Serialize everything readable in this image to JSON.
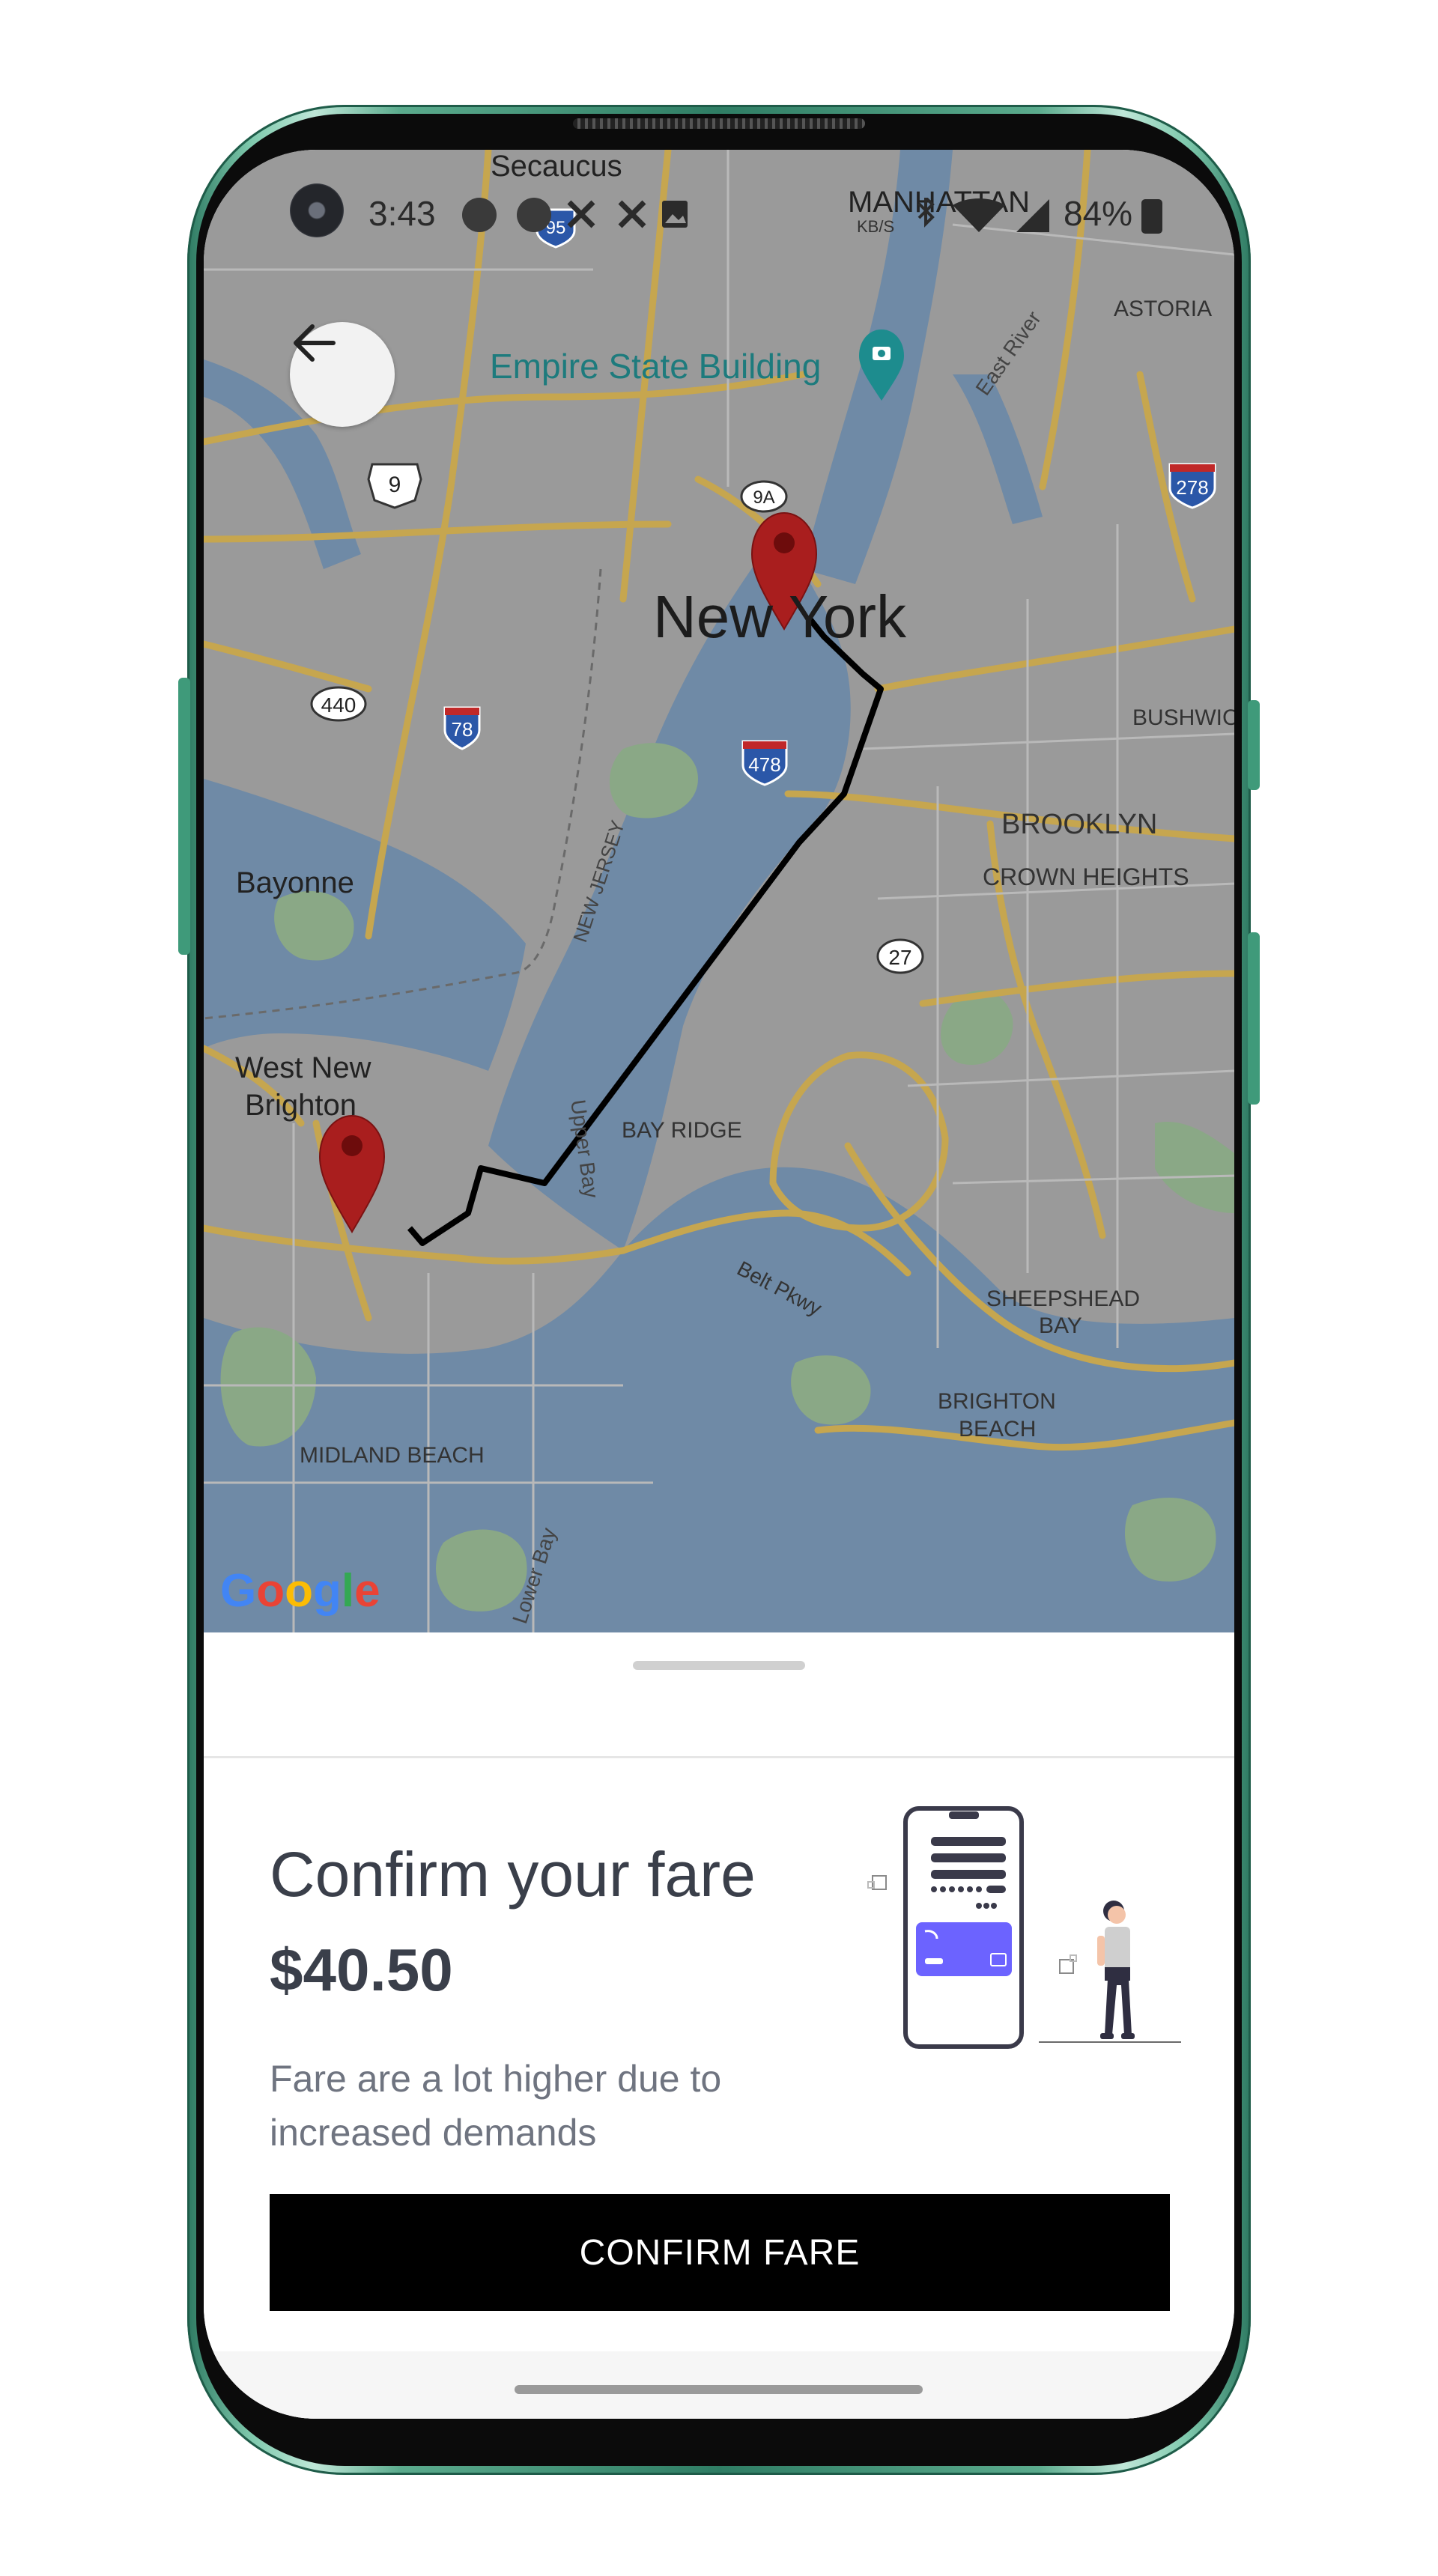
{
  "status_bar": {
    "time": "3:43",
    "speed_unit": "KB/S",
    "battery": "84%"
  },
  "map": {
    "labels": {
      "secaucus": "Secaucus",
      "manhattan": "MANHATTAN",
      "astoria": "ASTORIA",
      "empire_state": "Empire State Building",
      "east_river": "East River",
      "new_york": "New York",
      "bushwick": "BUSHWIC",
      "brooklyn": "BROOKLYN",
      "crown_heights": "CROWN HEIGHTS",
      "bayonne": "Bayonne",
      "new_jersey": "NEW JERSEY",
      "west_new_brighton_1": "West New",
      "west_new_brighton_2": "Brighton",
      "upper_bay": "Upper Bay",
      "bay_ridge": "BAY RIDGE",
      "belt_pkwy": "Belt Pkwy",
      "sheepshead_1": "SHEEPSHEAD",
      "sheepshead_2": "BAY",
      "brighton_beach_1": "BRIGHTON",
      "brighton_beach_2": "BEACH",
      "midland_beach": "MIDLAND BEACH",
      "lower_bay": "Lower Bay"
    },
    "shields": {
      "us9": "9",
      "r440": "440",
      "i78": "78",
      "i478": "478",
      "i278": "278",
      "r27": "27",
      "i95": "95",
      "r9a": "9A"
    },
    "attribution": {
      "g1": "G",
      "o1": "o",
      "o2": "o",
      "g2": "g",
      "l": "l",
      "e": "e"
    },
    "colors": {
      "land": "#9a9a9a",
      "water": "#6f8aa6",
      "road": "#c6a64f",
      "park": "#8aa886",
      "route": "#000000",
      "pin": "#a91e1e"
    }
  },
  "sheet": {
    "title": "Confirm your fare",
    "price": "$40.50",
    "description": "Fare are a lot higher due to increased demands",
    "button_label": "CONFIRM FARE"
  }
}
